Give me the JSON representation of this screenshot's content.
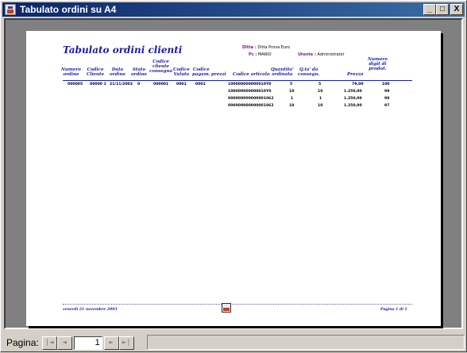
{
  "window": {
    "title": "Tabulato ordini su A4",
    "minimize_label": "_",
    "maximize_label": "□",
    "close_label": "X"
  },
  "report": {
    "title": "Tabulato ordini clienti",
    "meta": {
      "ditta_label": "Ditta :",
      "ditta_value": "Ditta Prova Euro",
      "pc_label": "Pc :",
      "pc_value": "MARIO",
      "utente_label": "Utente :",
      "utente_value": "Administrator"
    },
    "columns": [
      "Numero\nordine",
      "Codice\nCliente",
      "Data\nordine",
      "Stato\nordine",
      "Codice\ncliente\nconsegna",
      "Codice\nValuta",
      "Codice\npagam.",
      "prezzi",
      "Codice articolo",
      "Quantita'\nordinata",
      "Q.ta' da\nconsegn.",
      "Prezzo",
      "Numero\ndigit di\nprodot."
    ],
    "header_row": {
      "numero_ordine": "000005",
      "codice_cliente": "00000 1",
      "data_ordine": "21/11/2003",
      "stato_ordine": "0",
      "codice_cliente_consegna": "000001",
      "codice_valuta": "0001",
      "codice_pagam": "0001"
    },
    "lines": [
      {
        "articolo": "100000000000010Y0",
        "quantita": "5",
        "qta_consegn": "5",
        "prezzo": "79,00",
        "digit": "100"
      },
      {
        "articolo": "100000000000010Y0",
        "quantita": "10",
        "qta_consegn": "10",
        "prezzo": "1.250,00",
        "digit": "99"
      },
      {
        "articolo": "000000000000001062",
        "quantita": "1",
        "qta_consegn": "1",
        "prezzo": "1.250,00",
        "digit": "98"
      },
      {
        "articolo": "000000000000001062",
        "quantita": "10",
        "qta_consegn": "10",
        "prezzo": "1.250,00",
        "digit": "97"
      }
    ],
    "footer": {
      "date": "venerdì 21 novembre 2003",
      "page": "Pagina 1 di 1"
    }
  },
  "statusbar": {
    "page_label": "Pagina:",
    "page_value": "1",
    "first_icon": "first-page-icon",
    "prev_icon": "prev-page-icon",
    "next_icon": "next-page-icon",
    "last_icon": "last-page-icon"
  }
}
